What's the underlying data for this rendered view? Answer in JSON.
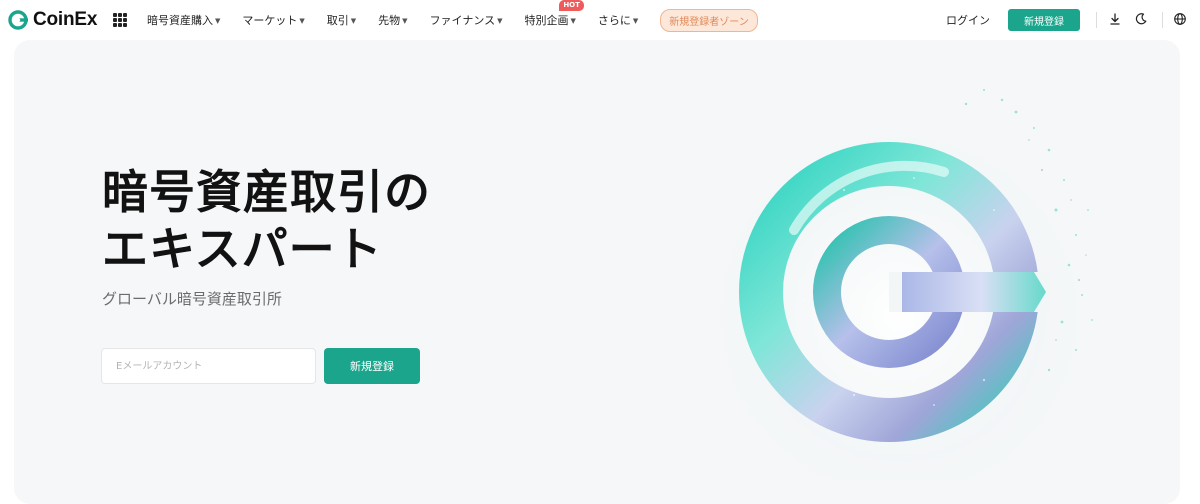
{
  "brand": {
    "name": "CoinEx",
    "accent_color": "#1aa58c"
  },
  "nav": {
    "items": [
      {
        "label": "暗号資産購入",
        "has_dropdown": true
      },
      {
        "label": "マーケット",
        "has_dropdown": true
      },
      {
        "label": "取引",
        "has_dropdown": true
      },
      {
        "label": "先物",
        "has_dropdown": true
      },
      {
        "label": "ファイナンス",
        "has_dropdown": true
      },
      {
        "label": "特別企画",
        "has_dropdown": true,
        "badge": "HOT"
      },
      {
        "label": "さらに",
        "has_dropdown": true
      }
    ],
    "promo": "新規登録者ゾーン",
    "login": "ログイン",
    "signup": "新規登録",
    "icons": [
      "apps-grid-icon",
      "download-icon",
      "moon-icon",
      "globe-icon"
    ]
  },
  "hero": {
    "title_line1": "暗号資産取引の",
    "title_line2": "エキスパート",
    "subtitle": "グローバル暗号資産取引所",
    "email_placeholder": "Eメールアカウント",
    "email_value": "",
    "signup_button": "新規登録",
    "art": "coinex-3d-logo"
  }
}
